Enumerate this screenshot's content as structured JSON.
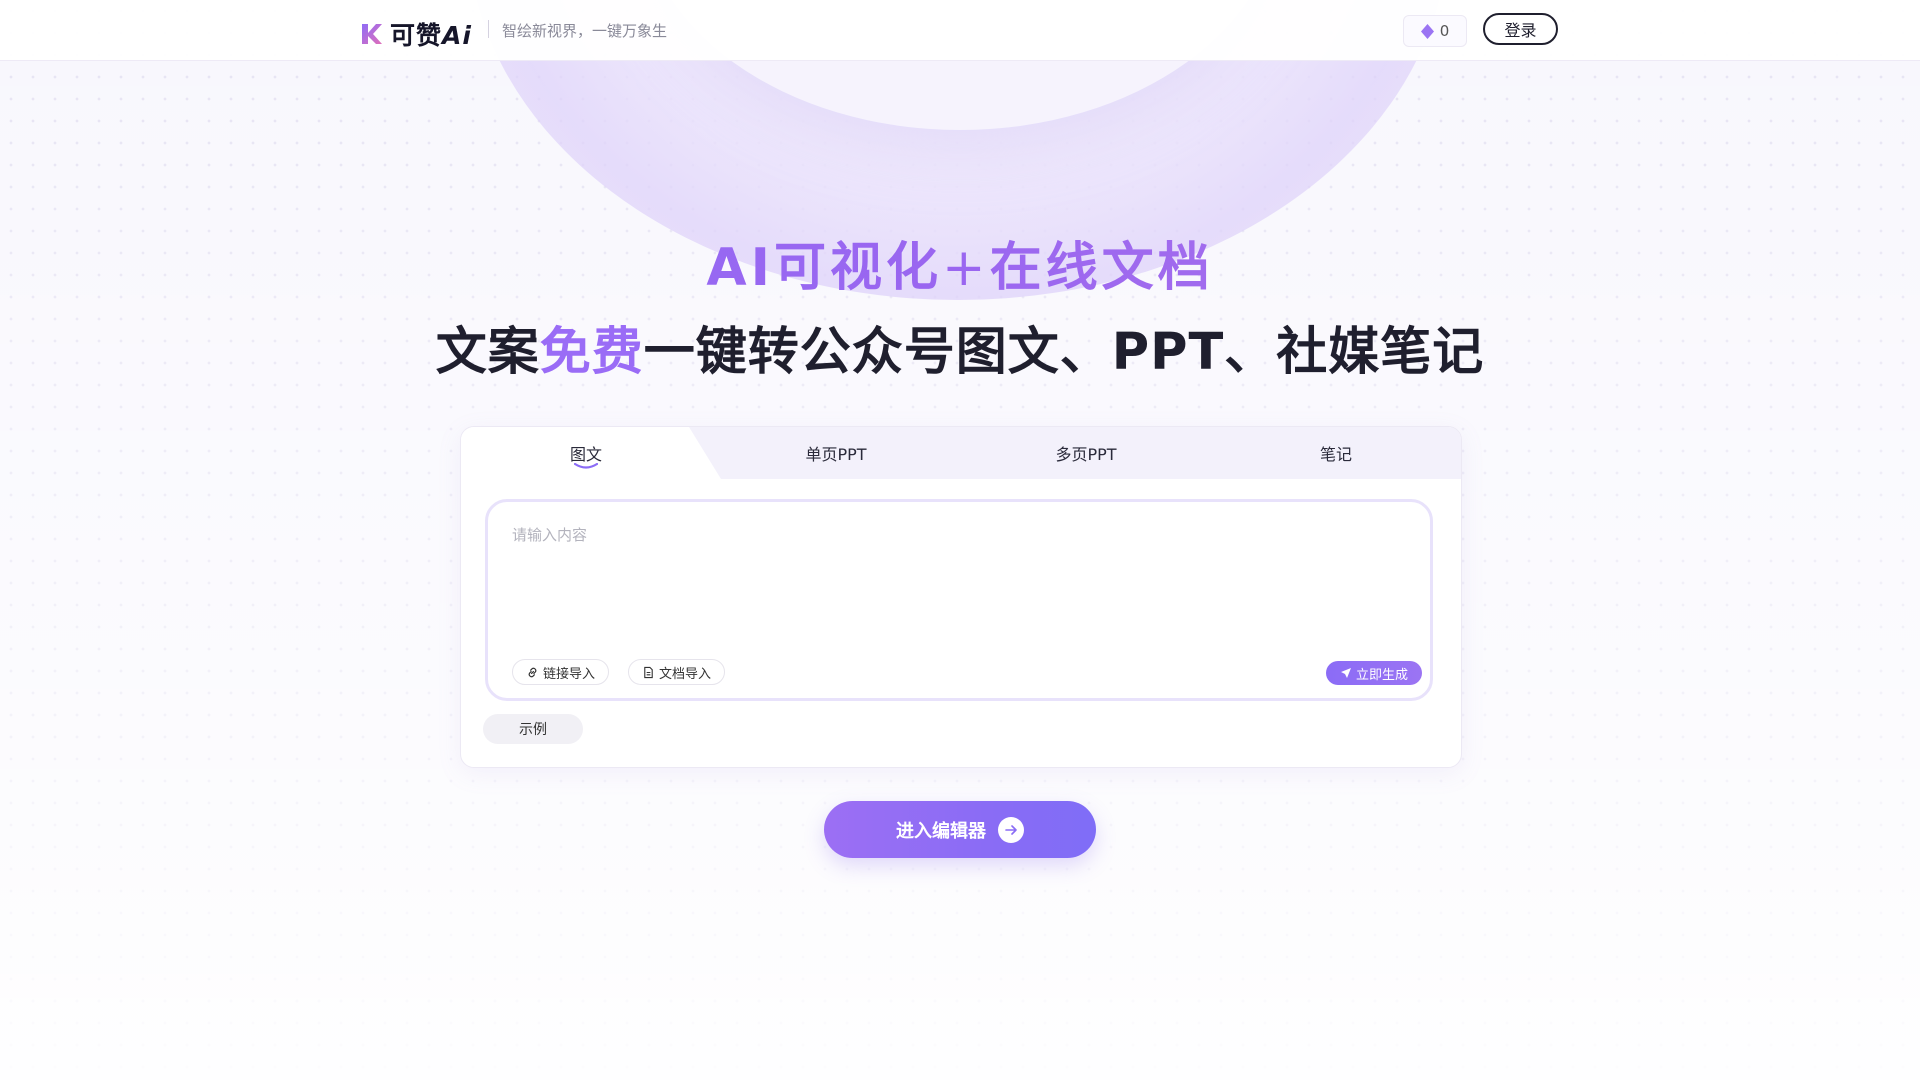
{
  "header": {
    "logo_text": "可赞",
    "logo_ai": "Ai",
    "slogan": "智绘新视界，一键万象生",
    "credits": "0",
    "login_label": "登录"
  },
  "hero": {
    "title_part1": "AI可视化",
    "title_plus": "+",
    "title_part2": "在线文档",
    "subtitle_prefix": "文案",
    "subtitle_highlight": "免费",
    "subtitle_suffix": "一键转公众号图文、PPT、社媒笔记"
  },
  "tabs": [
    {
      "label": "图文",
      "active": true
    },
    {
      "label": "单页PPT",
      "active": false
    },
    {
      "label": "多页PPT",
      "active": false
    },
    {
      "label": "笔记",
      "active": false
    }
  ],
  "editor": {
    "placeholder": "请输入内容",
    "value": "",
    "link_import_label": "链接导入",
    "doc_import_label": "文档导入",
    "generate_label": "立即生成"
  },
  "example_label": "示例",
  "enter_editor_label": "进入编辑器",
  "colors": {
    "accent": "#8b6cf6",
    "text": "#1f1f2e",
    "highlight": "#9a6cf6"
  },
  "icons": {
    "credits": "diamond-icon",
    "link_import": "link-icon",
    "doc_import": "document-icon",
    "generate": "send-icon",
    "enter_editor": "arrow-right-icon"
  }
}
